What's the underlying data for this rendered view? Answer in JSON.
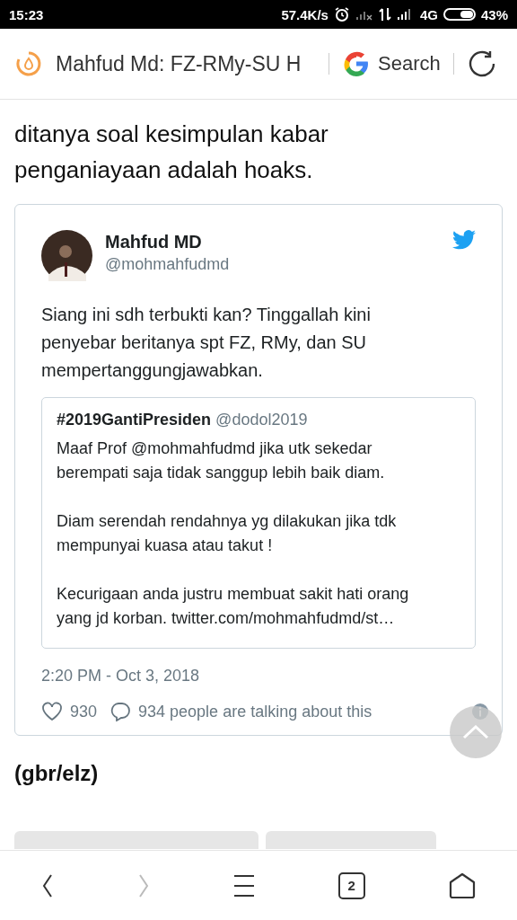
{
  "status_bar": {
    "time": "15:23",
    "speed": "57.4K/s",
    "network": "4G",
    "battery": "43%"
  },
  "toolbar": {
    "title": "Mahfud Md: FZ-RMy-SU H",
    "search": "Search"
  },
  "article": {
    "lines": [
      "ditanya soal kesimpulan kabar",
      "penganiayaan adalah hoaks."
    ],
    "credit": "(gbr/elz)"
  },
  "tweet": {
    "name": "Mahfud MD",
    "handle": "@mohmahfudmd",
    "text": "Siang ini sdh terbukti kan? Tinggallah kini penyebar beritanya spt FZ, RMy, dan SU mempertanggungjawabkan.",
    "quote": {
      "name": "#2019GantiPresiden",
      "handle": "@dodol2019",
      "paragraphs": [
        "Maaf Prof @mohmahfudmd jika utk sekedar berempati saja tidak sanggup lebih baik diam.",
        "Diam serendah rendahnya yg dilakukan jika tdk mempunyai kuasa atau takut !",
        "Kecurigaan anda justru membuat sakit hati orang yang jd korban. twitter.com/mohmahfudmd/st…"
      ]
    },
    "date": "2:20 PM - Oct 3, 2018",
    "likes": "930",
    "talking": "934 people are talking about this"
  },
  "tags": [
    {
      "kind": "tag"
    },
    {
      "kind": "tag"
    }
  ],
  "bottom_nav": {
    "tabs_count": "2",
    "forward_disabled": true
  }
}
